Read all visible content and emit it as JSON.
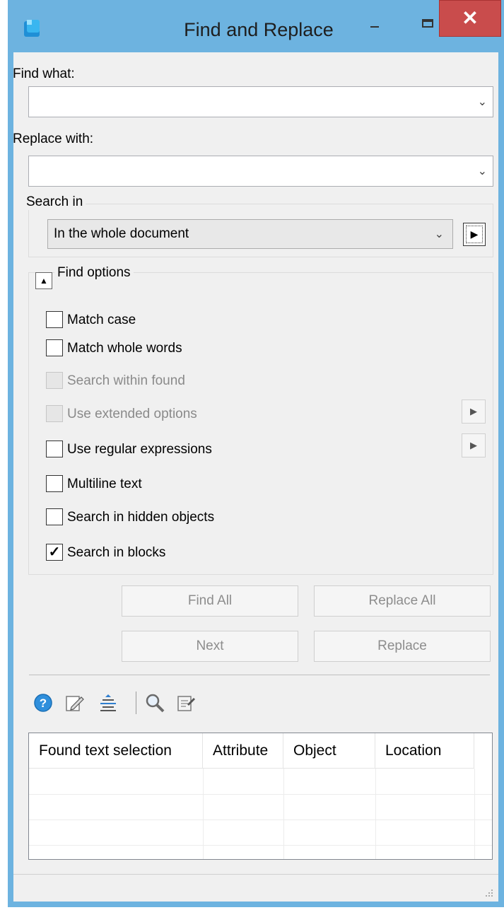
{
  "window": {
    "title": "Find and Replace",
    "close_glyph": "✕"
  },
  "find_what": {
    "label": "Find what:",
    "value": ""
  },
  "replace_with": {
    "label": "Replace with:",
    "value": ""
  },
  "search_in": {
    "group_label": "Search in",
    "selected": "In the whole document"
  },
  "find_options": {
    "group_label": "Find options",
    "options": [
      {
        "label": "Match case",
        "checked": false,
        "enabled": true
      },
      {
        "label": "Match whole words",
        "checked": false,
        "enabled": true
      },
      {
        "label": "Search within found",
        "checked": false,
        "enabled": false
      },
      {
        "label": "Use extended options",
        "checked": false,
        "enabled": false
      },
      {
        "label": "Use regular expressions",
        "checked": false,
        "enabled": true
      },
      {
        "label": "Multiline text",
        "checked": false,
        "enabled": true
      },
      {
        "label": "Search in hidden objects",
        "checked": false,
        "enabled": true
      },
      {
        "label": "Search in blocks",
        "checked": true,
        "enabled": true
      }
    ]
  },
  "buttons": {
    "find_all": "Find All",
    "replace_all": "Replace All",
    "next": "Next",
    "replace": "Replace"
  },
  "toolbar": {
    "icons": [
      "help-icon",
      "edit-note-icon",
      "align-center-icon",
      "magnifier-icon",
      "export-icon"
    ]
  },
  "results_table": {
    "columns": [
      "Found text selection",
      "Attribute",
      "Object",
      "Location"
    ],
    "rows": []
  },
  "colors": {
    "window_frame": "#6db3e0",
    "close_button": "#c94c4c",
    "dialog_bg": "#f0f0f0"
  }
}
